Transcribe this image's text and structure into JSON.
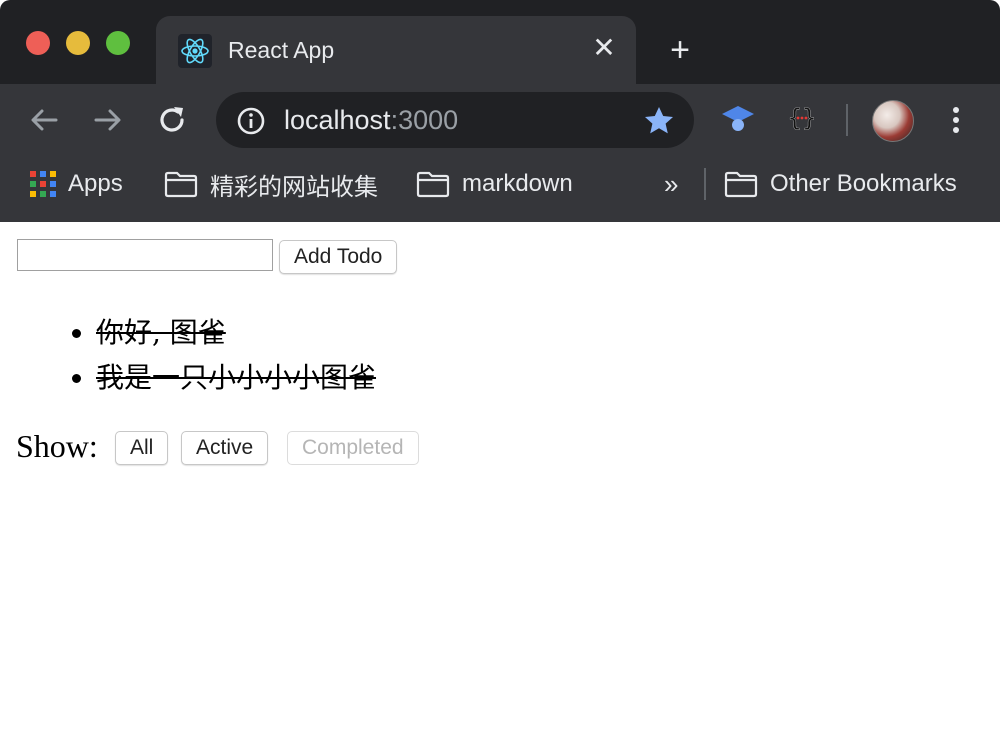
{
  "window": {
    "controls": [
      "close",
      "minimize",
      "zoom"
    ]
  },
  "tab": {
    "title": "React App",
    "favicon": "react-logo-icon",
    "close_glyph": "✕",
    "new_tab_glyph": "+"
  },
  "toolbar": {
    "url_host": "localhost",
    "url_port": ":3000",
    "icons": [
      "back-arrow-icon",
      "forward-arrow-icon",
      "reload-icon",
      "info-icon",
      "bookmark-star-icon",
      "graduation-cap-extension-icon",
      "json-formatter-extension-icon",
      "profile-avatar",
      "menu-dots-icon"
    ]
  },
  "bookmarks": {
    "items": [
      {
        "label": "Apps",
        "icon": "apps-grid-icon"
      },
      {
        "label": "精彩的网站收集",
        "icon": "folder-icon"
      },
      {
        "label": "markdown",
        "icon": "folder-icon"
      }
    ],
    "overflow_glyph": "»",
    "other": {
      "label": "Other Bookmarks",
      "icon": "folder-icon"
    }
  },
  "app": {
    "input_value": "",
    "add_button": "Add Todo",
    "todos": [
      {
        "text": "你好, 图雀",
        "completed": true
      },
      {
        "text": "我是一只小小小小图雀",
        "completed": true
      }
    ],
    "filter_label": "Show:",
    "filters": [
      {
        "label": "All",
        "active": false
      },
      {
        "label": "Active",
        "active": false
      },
      {
        "label": "Completed",
        "active": true
      }
    ]
  },
  "colors": {
    "chrome_dark": "#202124",
    "chrome_toolbar": "#35363a",
    "star_blue": "#8ab4f8",
    "react_teal": "#61dafb"
  }
}
